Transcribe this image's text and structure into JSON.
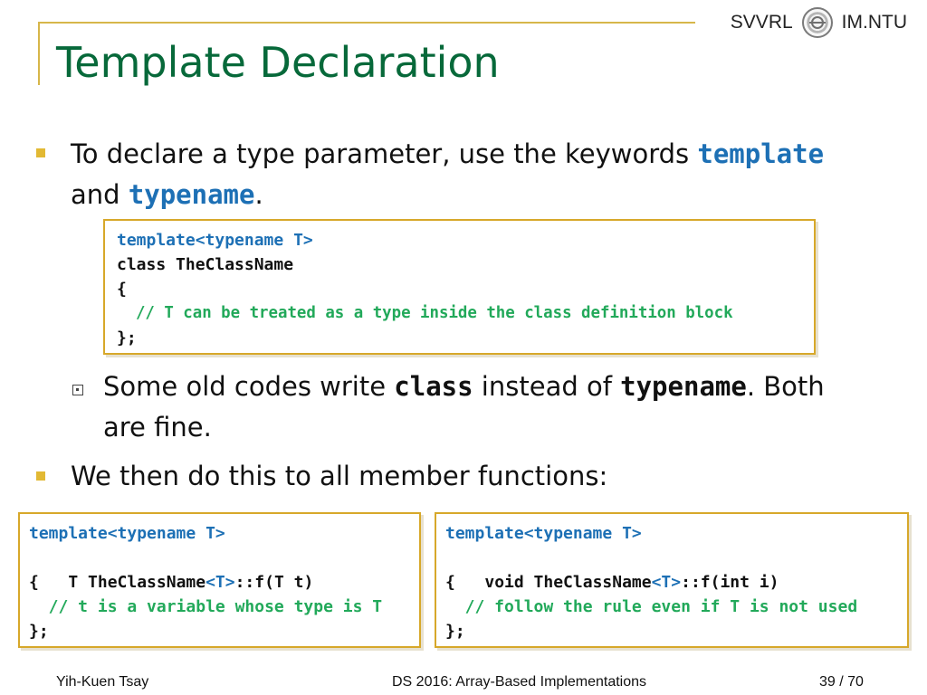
{
  "brand": {
    "left": "SVVRL",
    "right": "IM.NTU",
    "logo_icon": "ntu-seal-icon"
  },
  "title": "Template Declaration",
  "bullets": [
    {
      "line1_prefix": "To declare a type parameter, use the keywords ",
      "keyword1": "template",
      "line2_prefix": "and ",
      "keyword2": "typename",
      "suffix": "."
    },
    {
      "text": "We then do this to all member functions:"
    }
  ],
  "code1": {
    "line1": "template<typename T>",
    "line2": "class TheClassName",
    "line3": "{",
    "line4": "  // T can be treated as a type inside the class definition block",
    "line5": "};"
  },
  "subbullet": {
    "line1_prefix": "Some old codes write ",
    "keyword1": "class",
    "middle": " instead of ",
    "keyword2": "typename",
    "suffix": ". Both",
    "line2": "are fine."
  },
  "code2": {
    "line1": "template<typename T>",
    "line2_a": "T TheClassName",
    "line2_b": "<T>",
    "line2_c": "::f(T t)",
    "line3": "{",
    "line4": "  // t is a variable whose type is T",
    "line5": "};"
  },
  "code3": {
    "line1": "template<typename T>",
    "line2_a": "void TheClassName",
    "line2_b": "<T>",
    "line2_c": "::f(int i)",
    "line3": "{",
    "line4": "  // follow the rule even if T is not used",
    "line5": "};"
  },
  "footer": {
    "author": "Yih-Kuen Tsay",
    "course": "DS 2016: Array-Based Implementations",
    "page": "39",
    "total": "/ 70"
  },
  "colors": {
    "title": "#07693a",
    "accent": "#d7a82a",
    "keyword_blue": "#1d70b5",
    "comment_green": "#22a95a"
  }
}
